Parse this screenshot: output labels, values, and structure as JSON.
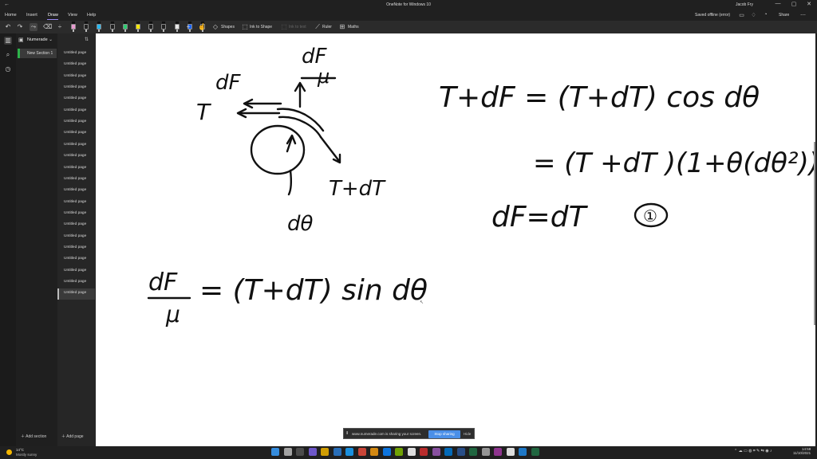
{
  "window": {
    "title": "OneNote for Windows 10",
    "user": "Jacob Fry",
    "back_glyph": "←",
    "min_glyph": "—",
    "max_glyph": "▢",
    "close_glyph": "✕"
  },
  "menu": {
    "tabs": [
      "Home",
      "Insert",
      "Draw",
      "View",
      "Help"
    ],
    "active_tab": "Draw",
    "status": "Saved offline (error)",
    "share_label": "Share"
  },
  "toolbar": {
    "shapes_label": "Shapes",
    "ink_to_shape_label": "Ink to Shape",
    "ink_to_text_label": "Ink to text",
    "ruler_label": "Ruler",
    "maths_label": "Maths",
    "pen_colors": [
      "#e89ad0",
      "#222222",
      "#28b8f0",
      "#222222",
      "#2ecc71",
      "#f5e600",
      "#222222",
      "#222222",
      "#e8e8e8",
      "#1a66ff",
      "#222222"
    ]
  },
  "notebook": {
    "name": "Numerade",
    "section": "New Section 1",
    "section_color": "#2db34a",
    "pages": [
      "Untitled page",
      "Untitled page",
      "Untitled page",
      "Untitled page",
      "Untitled page",
      "Untitled page",
      "Untitled page",
      "Untitled page",
      "Untitled page",
      "Untitled page",
      "Untitled page",
      "Untitled page",
      "Untitled page",
      "Untitled page",
      "Untitled page",
      "Untitled page",
      "Untitled page",
      "Untitled page",
      "Untitled page",
      "Untitled page",
      "Untitled page",
      "Untitled page"
    ],
    "add_section_label": "Add section",
    "add_page_label": "Add page"
  },
  "ink": {
    "dF_over_mu_top": "dF/μ",
    "dF": "dF",
    "T": "T",
    "T_plus_dT": "T+dT",
    "d_theta": "dθ",
    "eq1": "T+dF = (T+dT) cos dθ",
    "eq2": "= (T +dT )(1+θ(dθ²))",
    "eq3": "dF=dT",
    "eq3_label": "①",
    "eq4_lhs": "dF/μ",
    "eq4_rhs": "= (T+dT) sin dθ"
  },
  "share_banner": {
    "text": "www.numerade.com is sharing your screen.",
    "stop_label": "Stop sharing",
    "hide_label": "Hide"
  },
  "taskbar": {
    "temperature": "14°C",
    "condition": "Mostly sunny",
    "time": "14:58",
    "date": "11/10/2021"
  }
}
